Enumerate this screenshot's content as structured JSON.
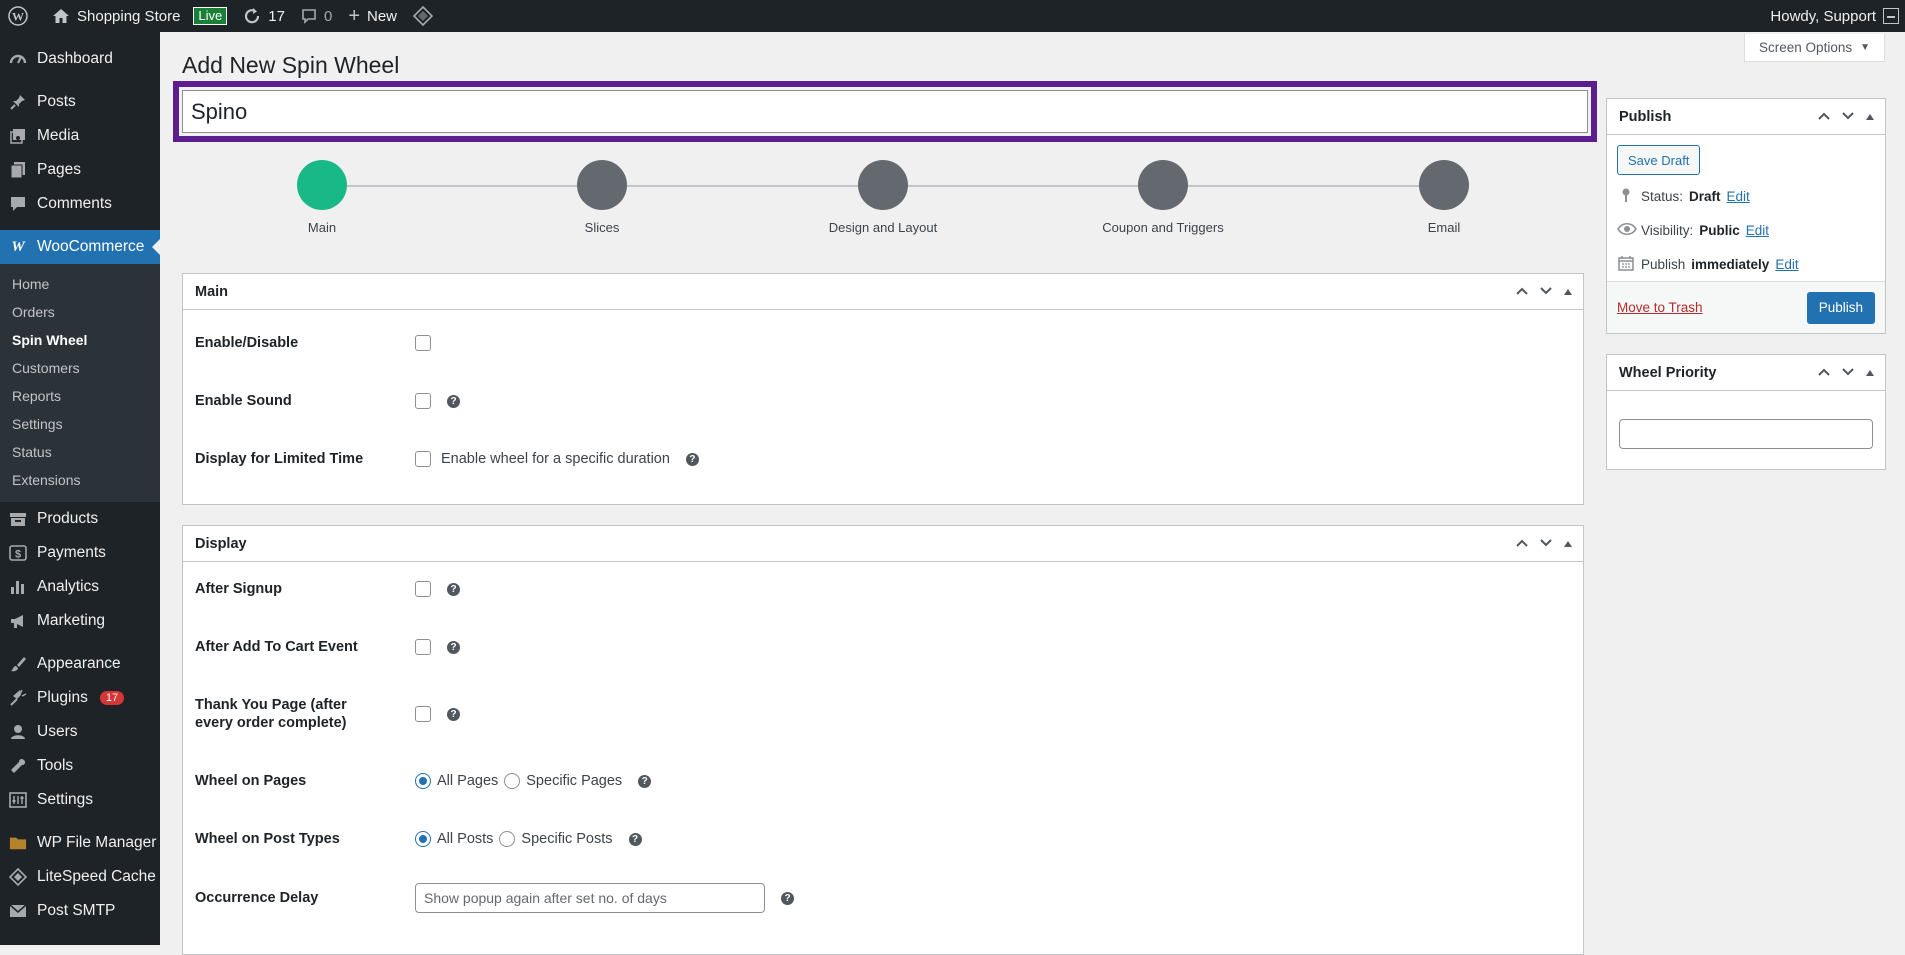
{
  "adminbar": {
    "site_name": "Shopping Store",
    "live_label": "Live",
    "updates_count": "17",
    "comments_count": "0",
    "new_label": "New",
    "howdy": "Howdy, Support"
  },
  "sidebar": {
    "top": [
      {
        "label": "Dashboard",
        "icon": "dashboard-icon"
      }
    ],
    "group1": [
      {
        "label": "Posts",
        "icon": "pin-icon"
      },
      {
        "label": "Media",
        "icon": "media-icon"
      },
      {
        "label": "Pages",
        "icon": "pages-icon"
      },
      {
        "label": "Comments",
        "icon": "comment-icon"
      }
    ],
    "woocommerce": "WooCommerce",
    "woo_sub": [
      "Home",
      "Orders",
      "Spin Wheel",
      "Customers",
      "Reports",
      "Settings",
      "Status",
      "Extensions"
    ],
    "group2": [
      {
        "label": "Products",
        "icon": "archive-icon"
      },
      {
        "label": "Payments",
        "icon": "dollar-icon"
      },
      {
        "label": "Analytics",
        "icon": "bar-chart-icon"
      },
      {
        "label": "Marketing",
        "icon": "megaphone-icon"
      }
    ],
    "group3": [
      {
        "label": "Appearance",
        "icon": "brush-icon"
      },
      {
        "label": "Plugins",
        "icon": "plugin-icon",
        "badge": "17"
      },
      {
        "label": "Users",
        "icon": "user-icon"
      },
      {
        "label": "Tools",
        "icon": "wrench-icon"
      },
      {
        "label": "Settings",
        "icon": "sliders-icon"
      }
    ],
    "group4": [
      {
        "label": "WP File Manager",
        "icon": "folder-icon"
      },
      {
        "label": "LiteSpeed Cache",
        "icon": "diamond-icon"
      },
      {
        "label": "Post SMTP",
        "icon": "mail-icon"
      }
    ]
  },
  "page": {
    "title": "Add New Spin Wheel",
    "screen_options": "Screen Options",
    "post_title": "Spino"
  },
  "steps": [
    "Main",
    "Slices",
    "Design and Layout",
    "Coupon and Triggers",
    "Email"
  ],
  "main_box": {
    "title": "Main",
    "enable_label": "Enable/Disable",
    "sound_label": "Enable Sound",
    "limited_label": "Display for Limited Time",
    "limited_text": "Enable wheel for a specific duration"
  },
  "display_box": {
    "title": "Display",
    "after_signup": "After Signup",
    "after_cart": "After Add To Cart Event",
    "thank_you": "Thank You Page (after every order complete)",
    "wheel_pages": "Wheel on Pages",
    "all_pages": "All Pages",
    "specific_pages": "Specific Pages",
    "wheel_post_types": "Wheel on Post Types",
    "all_posts": "All Posts",
    "specific_posts": "Specific Posts",
    "occurrence": "Occurrence Delay",
    "occurrence_placeholder": "Show popup again after set no. of days"
  },
  "publish": {
    "title": "Publish",
    "save_draft": "Save Draft",
    "status_label": "Status:",
    "status_value": "Draft",
    "visibility_label": "Visibility:",
    "visibility_value": "Public",
    "publish_label": "Publish",
    "publish_value": "immediately",
    "edit": "Edit",
    "trash": "Move to Trash",
    "publish_button": "Publish"
  },
  "priority": {
    "title": "Wheel Priority"
  }
}
